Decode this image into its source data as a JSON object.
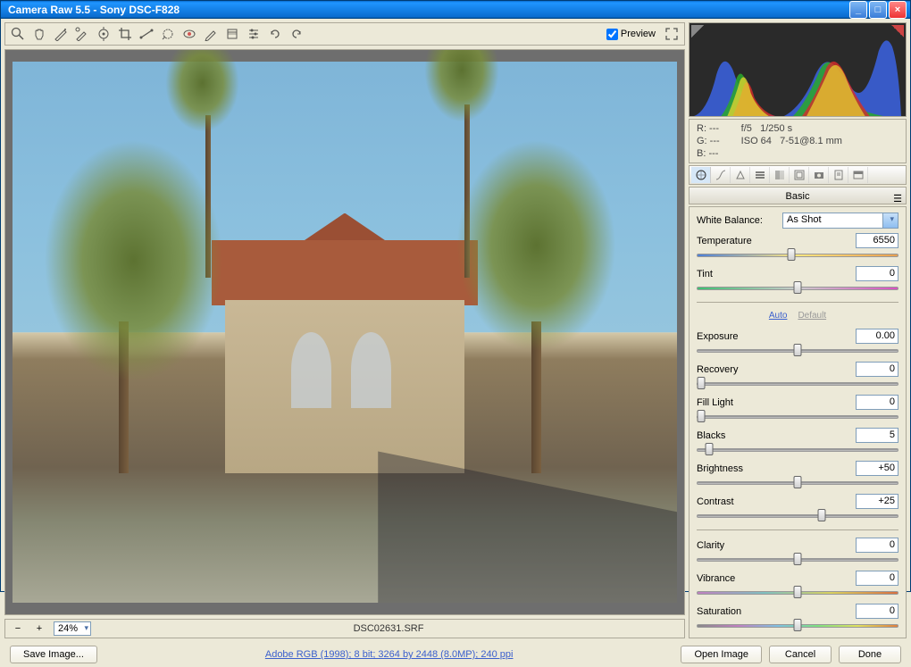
{
  "window": {
    "title": "Camera Raw 5.5  -  Sony DSC-F828"
  },
  "toolbar": {
    "preview_label": "Preview",
    "preview_checked": true
  },
  "image": {
    "filename": "DSC02631.SRF",
    "zoom": "24%"
  },
  "meta": {
    "r": "R:  ---",
    "g": "G:  ---",
    "b": "B:  ---",
    "aperture": "f/5",
    "shutter": "1/250 s",
    "iso": "ISO 64",
    "lens": "7-51@8.1 mm"
  },
  "panel": {
    "name": "Basic",
    "wb_label": "White Balance:",
    "wb_value": "As Shot",
    "auto": "Auto",
    "default": "Default",
    "sliders": {
      "temperature": {
        "label": "Temperature",
        "value": "6550",
        "pos": 47
      },
      "tint": {
        "label": "Tint",
        "value": "0",
        "pos": 50
      },
      "exposure": {
        "label": "Exposure",
        "value": "0.00",
        "pos": 50
      },
      "recovery": {
        "label": "Recovery",
        "value": "0",
        "pos": 2
      },
      "fill": {
        "label": "Fill Light",
        "value": "0",
        "pos": 2
      },
      "blacks": {
        "label": "Blacks",
        "value": "5",
        "pos": 6
      },
      "brightness": {
        "label": "Brightness",
        "value": "+50",
        "pos": 50
      },
      "contrast": {
        "label": "Contrast",
        "value": "+25",
        "pos": 62
      },
      "clarity": {
        "label": "Clarity",
        "value": "0",
        "pos": 50
      },
      "vibrance": {
        "label": "Vibrance",
        "value": "0",
        "pos": 50
      },
      "saturation": {
        "label": "Saturation",
        "value": "0",
        "pos": 50
      }
    }
  },
  "footer": {
    "save": "Save Image...",
    "meta": "Adobe RGB (1998); 8 bit; 3264 by 2448 (8.0MP); 240 ppi",
    "open": "Open Image",
    "cancel": "Cancel",
    "done": "Done"
  }
}
